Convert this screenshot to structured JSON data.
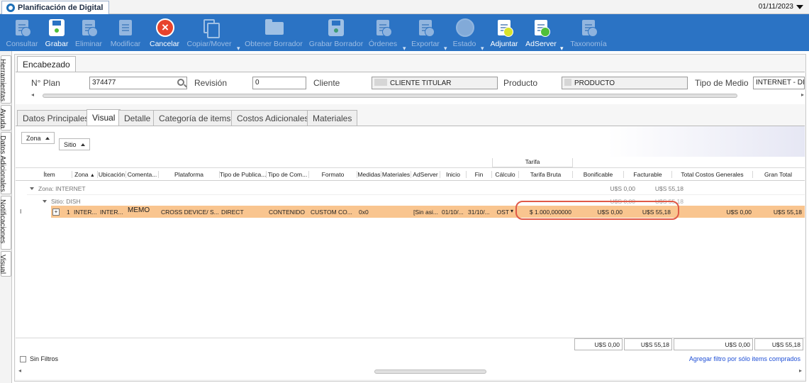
{
  "window": {
    "tab_title": "Planificación de Digital",
    "date": "01/11/2023"
  },
  "toolbar": {
    "buttons": [
      {
        "label": "Consultar",
        "icon": "search-document-icon",
        "enabled": false
      },
      {
        "label": "Grabar",
        "icon": "save-icon",
        "enabled": true
      },
      {
        "label": "Eliminar",
        "icon": "delete-document-icon",
        "enabled": false
      },
      {
        "label": "Modificar",
        "icon": "edit-document-icon",
        "enabled": false
      },
      {
        "label": "Cancelar",
        "icon": "cancel-icon",
        "enabled": true
      },
      {
        "label": "Copiar/Mover",
        "icon": "copy-icon",
        "enabled": false
      },
      {
        "label": "Obtener Borrador",
        "icon": "folder-icon",
        "enabled": false
      },
      {
        "label": "Grabar Borrador",
        "icon": "save-draft-icon",
        "enabled": false
      },
      {
        "label": "Órdenes",
        "icon": "orders-icon",
        "enabled": false
      },
      {
        "label": "Exportar",
        "icon": "export-icon",
        "enabled": false
      },
      {
        "label": "Estado",
        "icon": "status-globe-icon",
        "enabled": false
      },
      {
        "label": "Adjuntar",
        "icon": "attach-icon",
        "enabled": true
      },
      {
        "label": "AdServer",
        "icon": "adserver-icon",
        "enabled": true
      },
      {
        "label": "Taxonomía",
        "icon": "taxonomy-icon",
        "enabled": false
      }
    ]
  },
  "side_tabs": [
    "Herramientas",
    "Ayuda",
    "Datos Adicionales",
    "Notificaciones",
    "Visual"
  ],
  "header": {
    "tab_label": "Encabezado",
    "plan_label": "N° Plan",
    "plan_value": "374477",
    "revision_label": "Revisión",
    "revision_value": "0",
    "cliente_label": "Cliente",
    "cliente_value": "CLIENTE TITULAR",
    "producto_label": "Producto",
    "producto_value": "PRODUCTO",
    "medio_label": "Tipo de Medio",
    "medio_value": "INTERNET - DIGI"
  },
  "tabs": [
    "Datos Principales",
    "Visual",
    "Detalle",
    "Categoría de items",
    "Costos Adicionales",
    "Materiales"
  ],
  "selected_tab": "Visual",
  "group_panel": {
    "zona": "Zona",
    "sitio": "Sitio"
  },
  "grid": {
    "band_label": "Tarifa",
    "columns": [
      "Ítem",
      "Zona",
      "Ubicación",
      "Comenta...",
      "Plataforma",
      "Tipo de Publica...",
      "Tipo de Com...",
      "Formato",
      "Medidas",
      "Materiales",
      "AdServer",
      "Inicio",
      "Fin",
      "Cálculo",
      "Tarifa Bruta",
      "Bonificable",
      "Facturable",
      "Total Costos Generales",
      "Gran Total"
    ],
    "groups": [
      {
        "label": "Zona: INTERNET",
        "bonificable": "U$S 0,00",
        "facturable": "U$S 55,18"
      },
      {
        "label": "Sitio: DISH",
        "bonificable": "U$S 0,00",
        "facturable": "U$S 55,18"
      }
    ],
    "row": {
      "indicator": "I",
      "expander": "+",
      "item": "1",
      "zona": "INTER...",
      "ubicacion": "INTER...",
      "comentario": "MEMO",
      "plataforma": "CROSS DEVICE/ S...",
      "tipo_publicacion": "DIRECT",
      "tipo_compra": "CONTENIDO",
      "formato": "CUSTOM CO...",
      "medidas": "0x0",
      "materiales": "",
      "adserver": "[Sin asi...",
      "inicio": "01/10/...",
      "fin": "31/10/...",
      "calculo": "OST",
      "tarifa_bruta": "$ 1.000,000000",
      "bonificable": "U$S 0,00",
      "facturable": "U$S 55,18",
      "total_costos": "U$S 0,00",
      "gran_total": "U$S 55,18"
    },
    "totals": {
      "bonificable": "U$S 0,00",
      "facturable": "U$S 55,18",
      "total_costos": "U$S 0,00",
      "gran_total": "U$S 55,18"
    },
    "footer": {
      "filter_label": "Sin Filtros",
      "link": "Agregar filtro por sólo items comprados"
    }
  },
  "colors": {
    "toolbar": "#2b73c4",
    "row_highlight": "#f9c58f",
    "callout": "#e05a48",
    "link": "#1f4fd6"
  }
}
